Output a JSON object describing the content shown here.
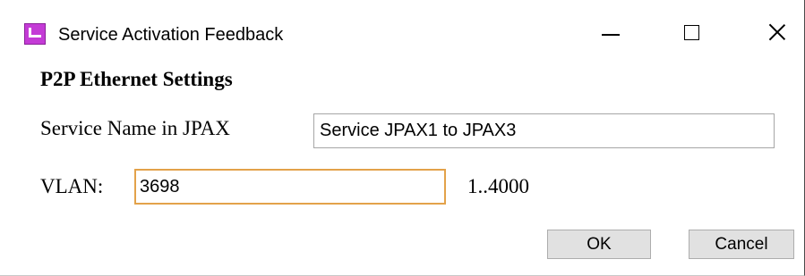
{
  "window": {
    "title": "Service Activation Feedback",
    "app_icon": "app-icon",
    "controls": {
      "minimize_icon": "minimize-icon",
      "maximize_icon": "maximize-icon",
      "close_icon": "close-icon"
    }
  },
  "form": {
    "section_title": "P2P Ethernet Settings",
    "service_name": {
      "label": "Service Name in JPAX",
      "value": "Service JPAX1 to JPAX3"
    },
    "vlan": {
      "label": "VLAN:",
      "value": "3698",
      "range_hint": "1..4000"
    }
  },
  "buttons": {
    "ok_label": "OK",
    "cancel_label": "Cancel"
  },
  "colors": {
    "focus_border": "#e3a24a",
    "button_bg": "#e1e1e1",
    "app_icon": "#c43bd6"
  }
}
